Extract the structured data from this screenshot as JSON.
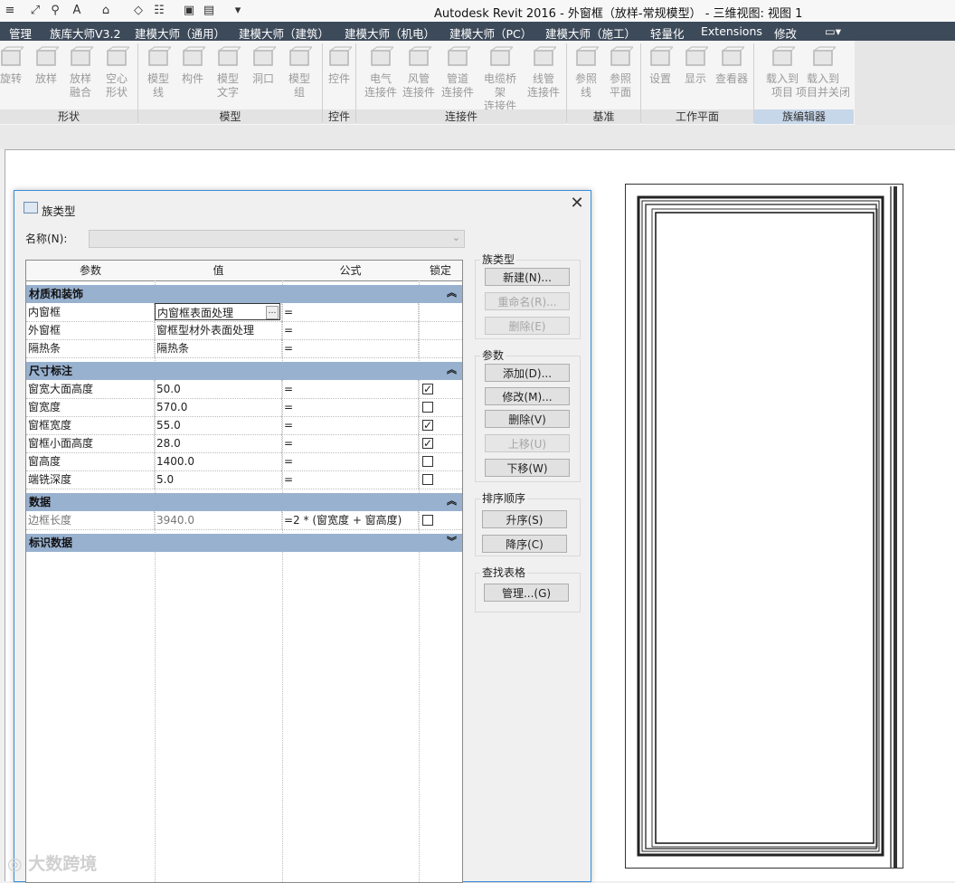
{
  "app": {
    "title": "Autodesk Revit 2016 -    外窗框（放样-常规模型） - 三维视图: 视图 1"
  },
  "quick_access": [
    "≡",
    "⤢",
    "⚲",
    "A",
    "⌂",
    "◇",
    "☷",
    "▣",
    "▤",
    "▾"
  ],
  "menu_tabs": [
    "管理",
    "族库大师V3.2",
    "建模大师（通用）",
    "建模大师（建筑）",
    "建模大师（机电）",
    "建模大师（PC）",
    "建模大师（施工）",
    "轻量化",
    "Extensions",
    "修改"
  ],
  "ribbon": {
    "buttons": [
      {
        "l1": "旋转",
        "l2": ""
      },
      {
        "l1": "放样",
        "l2": ""
      },
      {
        "l1": "放样",
        "l2": "融合"
      },
      {
        "l1": "空心",
        "l2": "形状"
      },
      {
        "l1": "模型",
        "l2": "线"
      },
      {
        "l1": "构件",
        "l2": ""
      },
      {
        "l1": "模型",
        "l2": "文字"
      },
      {
        "l1": "洞口",
        "l2": ""
      },
      {
        "l1": "模型",
        "l2": "组"
      },
      {
        "l1": "控件",
        "l2": ""
      },
      {
        "l1": "电气",
        "l2": "连接件"
      },
      {
        "l1": "风管",
        "l2": "连接件"
      },
      {
        "l1": "管道",
        "l2": "连接件"
      },
      {
        "l1": "电缆桥架",
        "l2": "连接件"
      },
      {
        "l1": "线管",
        "l2": "连接件"
      },
      {
        "l1": "参照",
        "l2": "线"
      },
      {
        "l1": "参照",
        "l2": "平面"
      },
      {
        "l1": "设置",
        "l2": ""
      },
      {
        "l1": "显示",
        "l2": ""
      },
      {
        "l1": "查看器",
        "l2": ""
      },
      {
        "l1": "载入到",
        "l2": "项目"
      },
      {
        "l1": "载入到",
        "l2": "项目并关闭"
      }
    ],
    "groups": [
      "形状",
      "模型",
      "控件",
      "连接件",
      "基准",
      "工作平面",
      "族编辑器"
    ]
  },
  "dialog": {
    "title": "族类型",
    "close": "✕",
    "name_label": "名称(N):",
    "name_value": "",
    "headers": [
      "参数",
      "值",
      "公式",
      "锁定"
    ],
    "groups": [
      {
        "name": "材质和装饰",
        "chevron": "︽",
        "rows": [
          {
            "param": "内窗框",
            "value": "内窗框表面处理",
            "formula": "=",
            "lock": null
          },
          {
            "param": "外窗框",
            "value": "窗框型材外表面处理",
            "formula": "=",
            "lock": null
          },
          {
            "param": "隔热条",
            "value": "隔热条",
            "formula": "=",
            "lock": null
          }
        ]
      },
      {
        "name": "尺寸标注",
        "chevron": "︽",
        "rows": [
          {
            "param": "窗宽大面高度",
            "value": "50.0",
            "formula": "=",
            "lock": true
          },
          {
            "param": "窗宽度",
            "value": "570.0",
            "formula": "=",
            "lock": false
          },
          {
            "param": "窗框宽度",
            "value": "55.0",
            "formula": "=",
            "lock": true
          },
          {
            "param": "窗框小面高度",
            "value": "28.0",
            "formula": "=",
            "lock": true
          },
          {
            "param": "窗高度",
            "value": "1400.0",
            "formula": "=",
            "lock": false
          },
          {
            "param": "端铣深度",
            "value": "5.0",
            "formula": "=",
            "lock": false
          }
        ]
      },
      {
        "name": "数据",
        "chevron": "︽",
        "rows": [
          {
            "param": "边框长度",
            "value": "3940.0",
            "formula": "=2 * (窗宽度 + 窗高度)",
            "lock": false
          }
        ]
      },
      {
        "name": "标识数据",
        "chevron": "︾",
        "rows": []
      }
    ],
    "family_types": {
      "label": "族类型",
      "new": "新建(N)...",
      "rename": "重命名(R)...",
      "delete": "删除(E)"
    },
    "parameters": {
      "label": "参数",
      "add": "添加(D)...",
      "modify": "修改(M)...",
      "delete": "删除(V)",
      "move_up": "上移(U)",
      "move_down": "下移(W)"
    },
    "sort": {
      "label": "排序顺序",
      "asc": "升序(S)",
      "desc": "降序(C)"
    },
    "lookup": {
      "label": "查找表格",
      "manage": "管理...(G)"
    }
  },
  "watermark": "大数跨境",
  "colors": {
    "menubar": "#3d4a5a",
    "group_row": "#98b1cf",
    "dialog_border": "#3b8dd8"
  }
}
